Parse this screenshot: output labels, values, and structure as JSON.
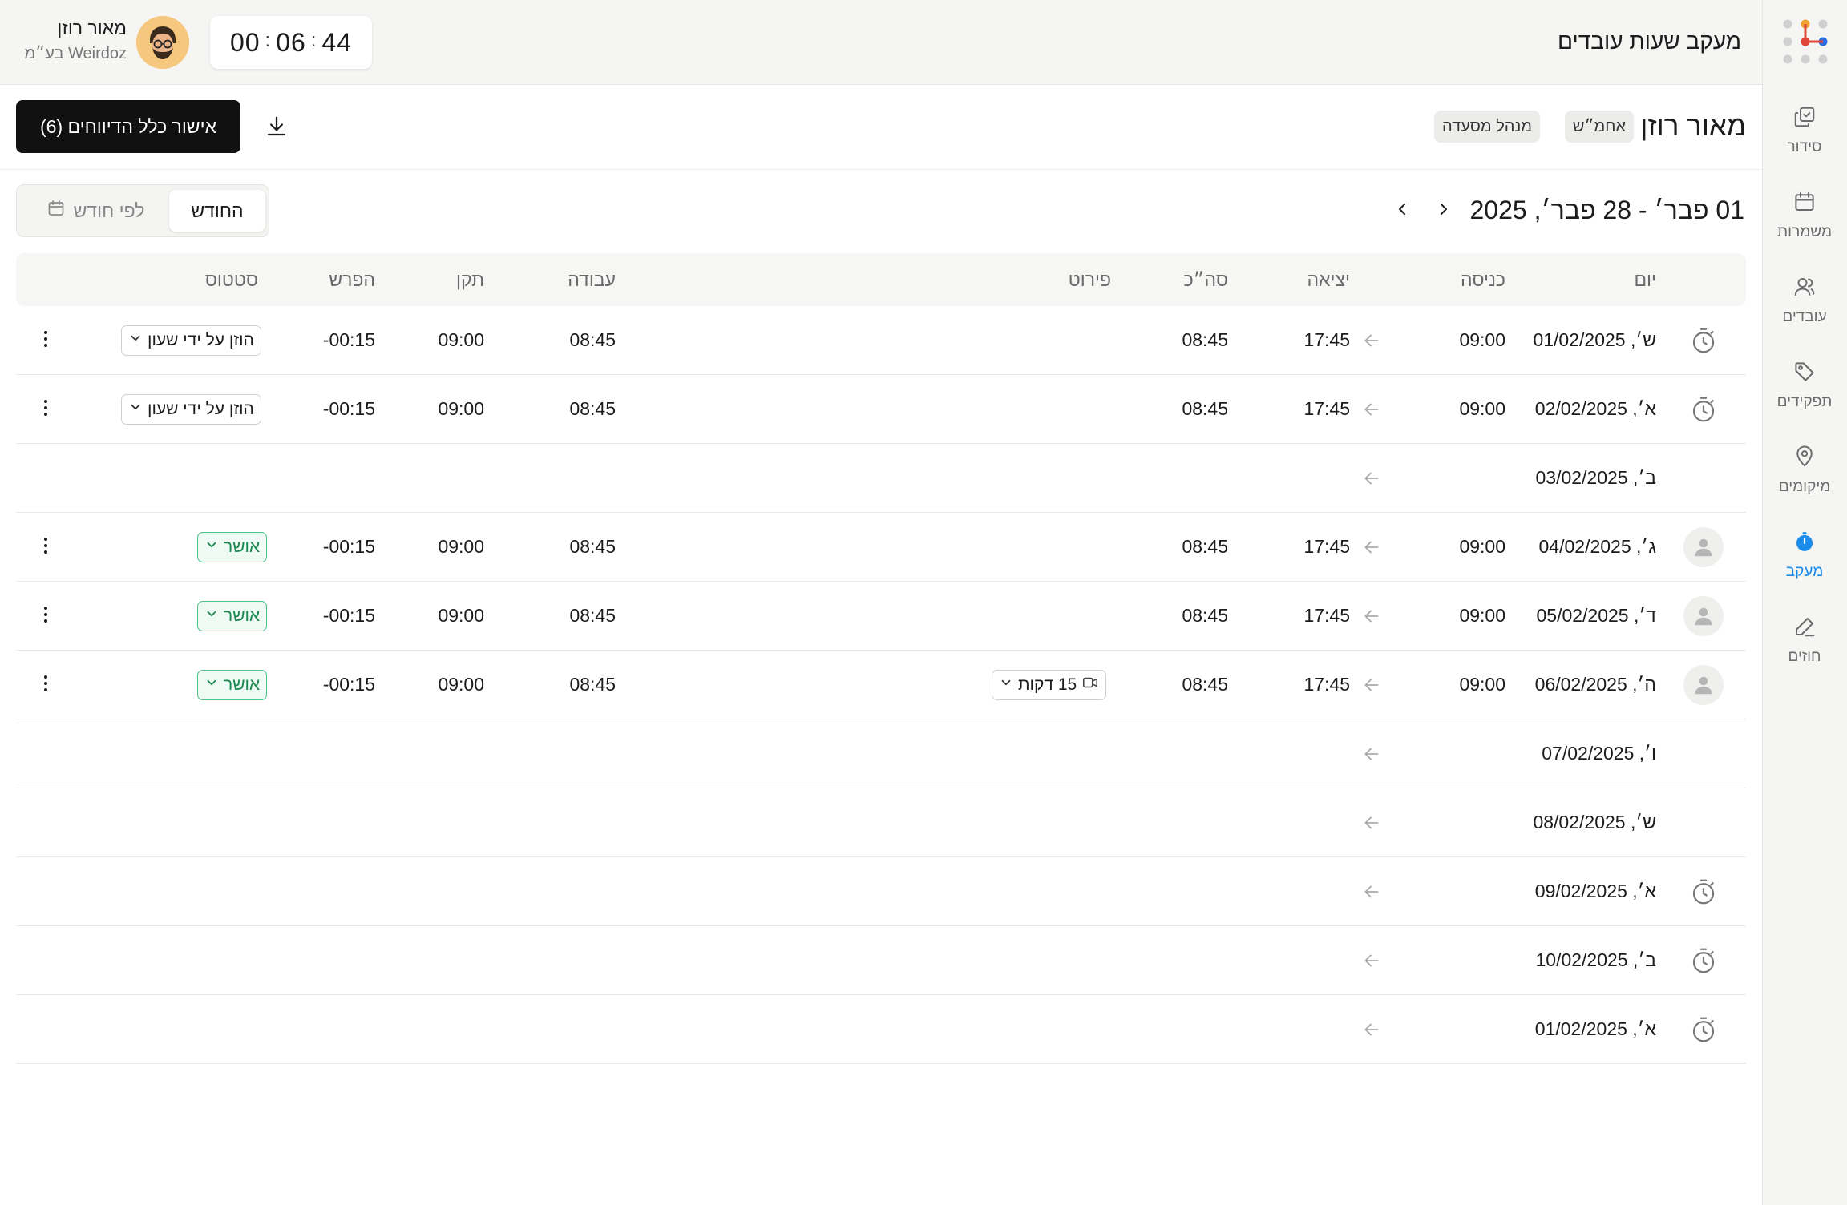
{
  "app": {
    "title": "מעקב שעות עובדים"
  },
  "timer": {
    "hours": "00",
    "minutes": "06",
    "seconds": "44",
    "separator": ":"
  },
  "user": {
    "name": "מאור רוזן",
    "company": "Weirdoz בע״מ"
  },
  "sidebar": {
    "items": [
      {
        "label": "סידור",
        "icon": "schedule-icon",
        "active": false
      },
      {
        "label": "משמרות",
        "icon": "calendar-icon",
        "active": false
      },
      {
        "label": "עובדים",
        "icon": "users-icon",
        "active": false
      },
      {
        "label": "תפקידים",
        "icon": "tag-icon",
        "active": false
      },
      {
        "label": "מיקומים",
        "icon": "location-pin-icon",
        "active": false
      },
      {
        "label": "מעקב",
        "icon": "stopwatch-icon",
        "active": true
      },
      {
        "label": "חוזים",
        "icon": "pen-icon",
        "active": false
      }
    ]
  },
  "employee": {
    "name": "מאור רוזן",
    "tags": [
      "אחמ״ש",
      "מנהל מסעדה"
    ]
  },
  "actions": {
    "approve_all": "אישור כלל הדיווחים (6)"
  },
  "range": {
    "label": "01 פבר׳ - 28 פבר׳, 2025"
  },
  "view_toggle": {
    "current": "החודש",
    "by_month": "לפי חודש"
  },
  "table": {
    "headers": {
      "day": "יום",
      "entry": "כניסה",
      "exit": "יציאה",
      "total": "סה״כ",
      "details": "פירוט",
      "work": "עבודה",
      "standard": "תקן",
      "diff": "הפרש",
      "status": "סטטוס"
    },
    "rows": [
      {
        "icon": "stopwatch",
        "day": "ש׳, 01/02/2025",
        "entry": "09:00",
        "exit": "17:45",
        "total": "08:45",
        "details": "",
        "work": "08:45",
        "standard": "09:00",
        "diff": "-00:15",
        "status": "הוזן על ידי שעון",
        "status_type": "entered"
      },
      {
        "icon": "stopwatch",
        "day": "א׳, 02/02/2025",
        "entry": "09:00",
        "exit": "17:45",
        "total": "08:45",
        "details": "",
        "work": "08:45",
        "standard": "09:00",
        "diff": "-00:15",
        "status": "הוזן על ידי שעון",
        "status_type": "entered"
      },
      {
        "icon": "",
        "day": "ב׳, 03/02/2025",
        "entry": "",
        "exit": "",
        "total": "",
        "details": "",
        "work": "",
        "standard": "",
        "diff": "",
        "status": "",
        "status_type": ""
      },
      {
        "icon": "user",
        "day": "ג׳, 04/02/2025",
        "entry": "09:00",
        "exit": "17:45",
        "total": "08:45",
        "details": "",
        "work": "08:45",
        "standard": "09:00",
        "diff": "-00:15",
        "status": "אושר",
        "status_type": "approved"
      },
      {
        "icon": "user",
        "day": "ד׳, 05/02/2025",
        "entry": "09:00",
        "exit": "17:45",
        "total": "08:45",
        "details": "",
        "work": "08:45",
        "standard": "09:00",
        "diff": "-00:15",
        "status": "אושר",
        "status_type": "approved"
      },
      {
        "icon": "user",
        "day": "ה׳, 06/02/2025",
        "entry": "09:00",
        "exit": "17:45",
        "total": "08:45",
        "details": "15 דקות",
        "work": "08:45",
        "standard": "09:00",
        "diff": "-00:15",
        "status": "אושר",
        "status_type": "approved"
      },
      {
        "icon": "",
        "day": "ו׳, 07/02/2025",
        "entry": "",
        "exit": "",
        "total": "",
        "details": "",
        "work": "",
        "standard": "",
        "diff": "",
        "status": "",
        "status_type": ""
      },
      {
        "icon": "",
        "day": "ש׳, 08/02/2025",
        "entry": "",
        "exit": "",
        "total": "",
        "details": "",
        "work": "",
        "standard": "",
        "diff": "",
        "status": "",
        "status_type": ""
      },
      {
        "icon": "stopwatch",
        "day": "א׳, 09/02/2025",
        "entry": "",
        "exit": "",
        "total": "",
        "details": "",
        "work": "",
        "standard": "",
        "diff": "",
        "status": "",
        "status_type": ""
      },
      {
        "icon": "stopwatch",
        "day": "ב׳, 10/02/2025",
        "entry": "",
        "exit": "",
        "total": "",
        "details": "",
        "work": "",
        "standard": "",
        "diff": "",
        "status": "",
        "status_type": ""
      },
      {
        "icon": "stopwatch",
        "day": "א׳, 01/02/2025",
        "entry": "",
        "exit": "",
        "total": "",
        "details": "",
        "work": "",
        "standard": "",
        "diff": "",
        "status": "",
        "status_type": ""
      }
    ]
  },
  "colors": {
    "accent": "#1a8be8",
    "approved": "#1b8a52",
    "approved_bg": "#eefaf3",
    "primary_button": "#111111",
    "sidebar_bg": "#f5f5f3"
  }
}
